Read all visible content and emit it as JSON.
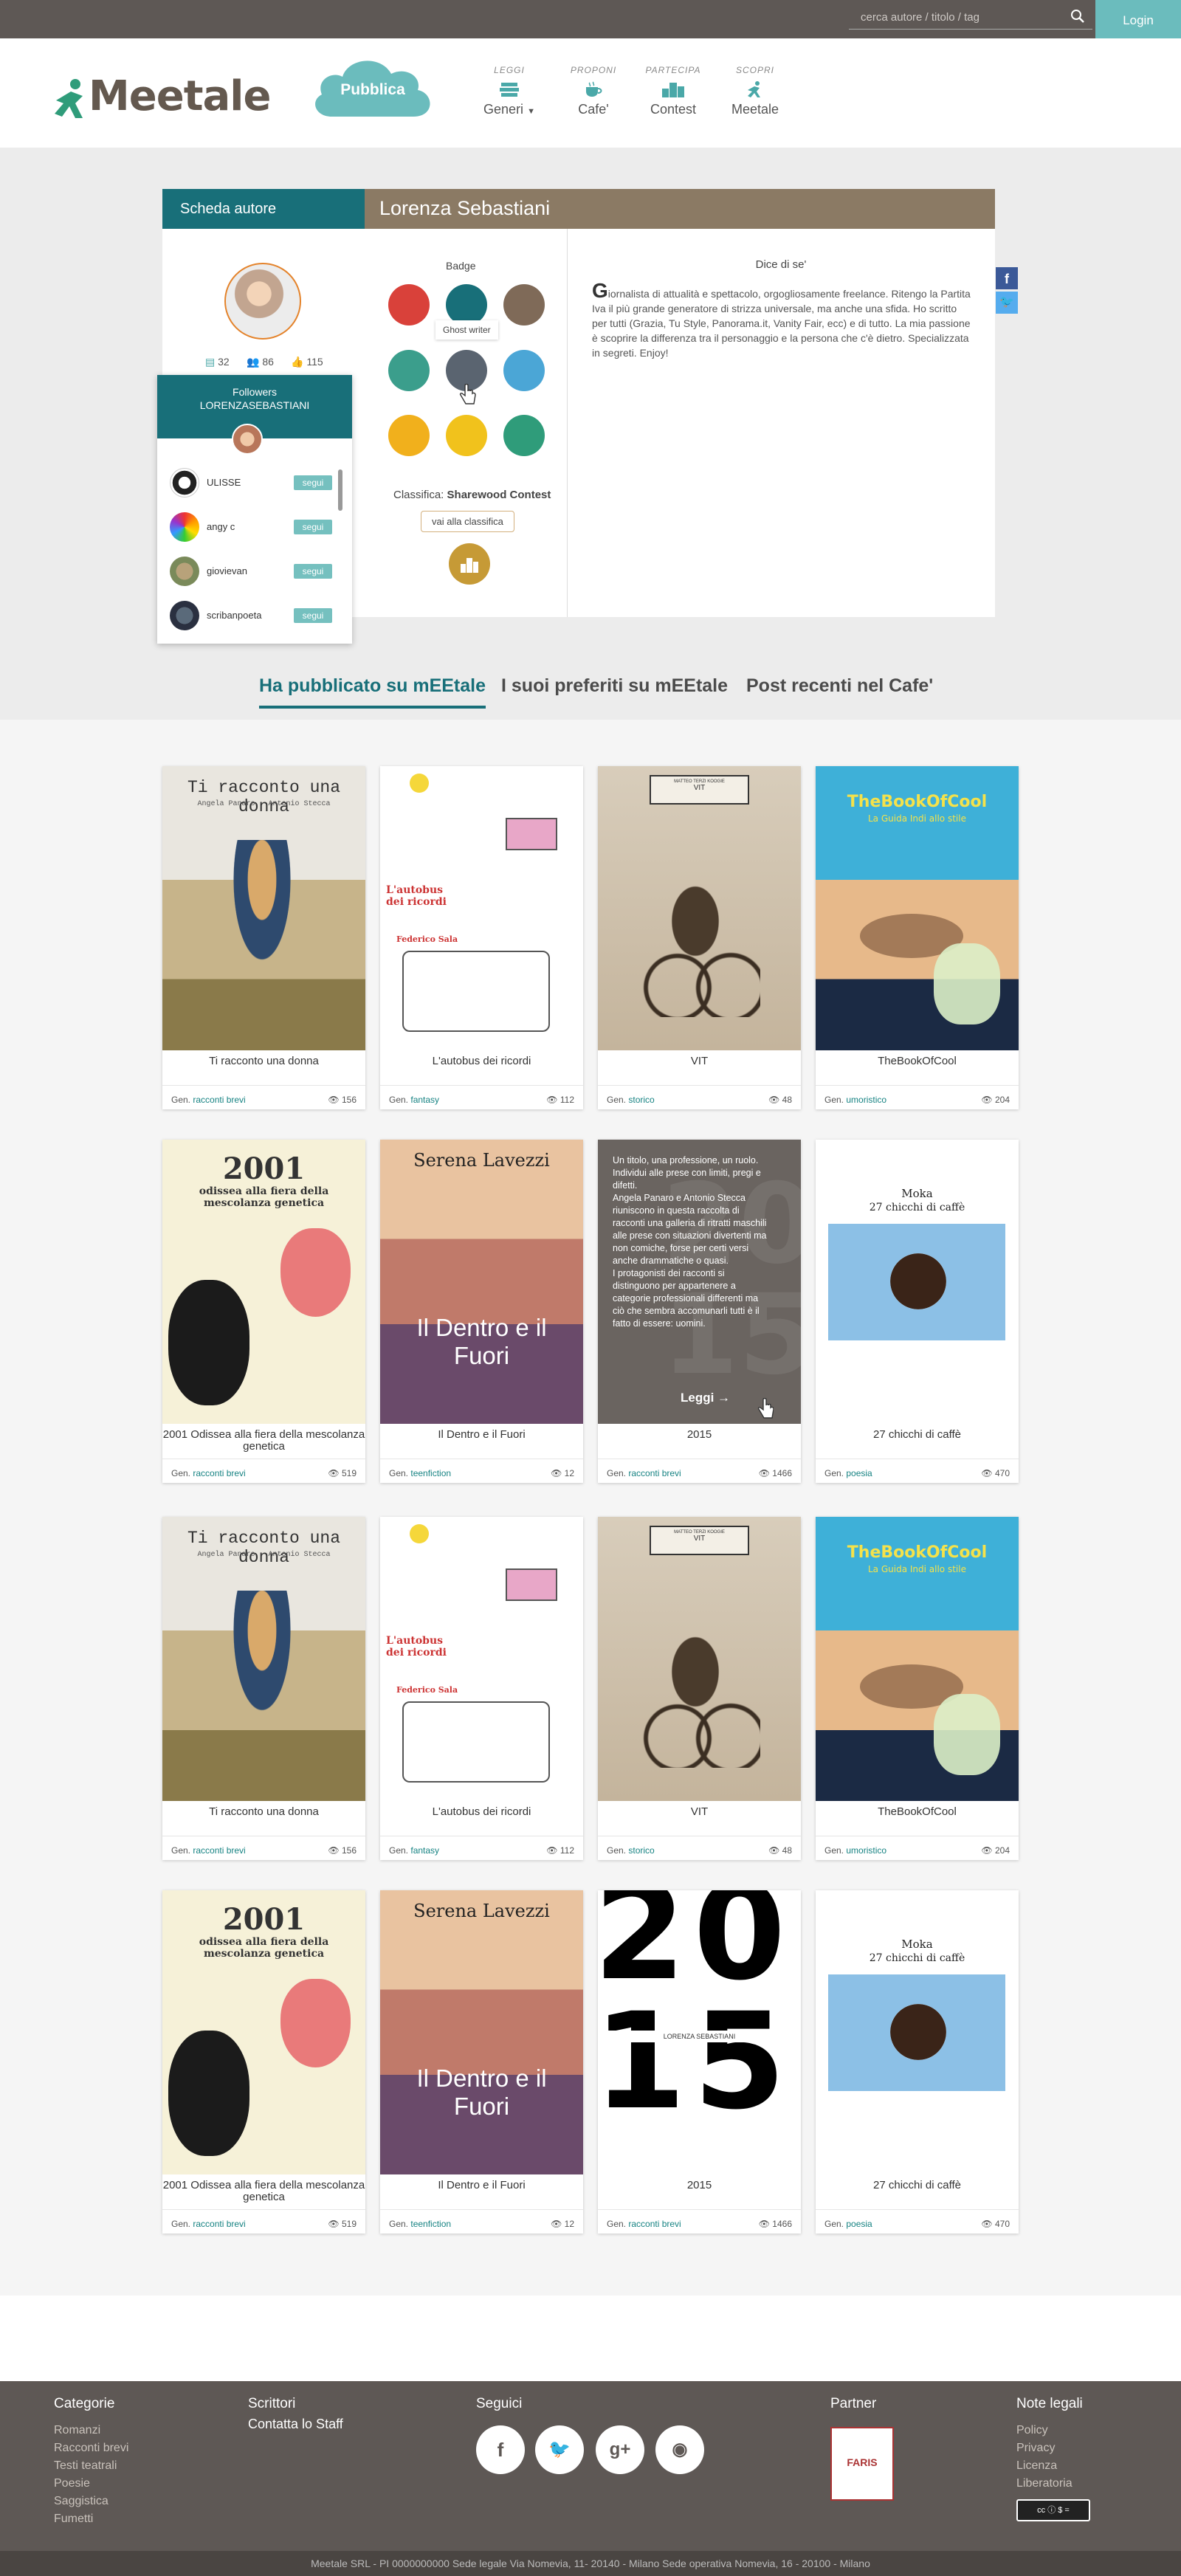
{
  "topbar": {
    "search_placeholder": "cerca autore / titolo / tag",
    "login": "Login"
  },
  "header": {
    "logo": "Meetale",
    "pubblica": "Pubblica",
    "nav": [
      {
        "caption": "LEGGI",
        "label": "Generi"
      },
      {
        "caption": "PROPONI",
        "label": "Cafe'"
      },
      {
        "caption": "PARTECIPA",
        "label": "Contest"
      },
      {
        "caption": "SCOPRI",
        "label": "Meetale"
      }
    ]
  },
  "author": {
    "scheda": "Scheda autore",
    "name": "Lorenza Sebastiani",
    "stats": [
      "32",
      "86",
      "115"
    ],
    "badge_label": "Badge",
    "ghost_tooltip": "Ghost writer",
    "classifica_label": "Classifica:",
    "classifica_name": "Sharewood Contest",
    "vai_classifica": "vai alla classifica",
    "dice_title": "Dice di se'",
    "bio": "Giornalista di attualità e spettacolo, orgogliosamente freelance. Ritengo la Partita Iva il più grande generatore di strizza universale, ma anche una sfida. Ho scritto per tutti (Grazia, Tu Style, Panorama.it, Vanity Fair, ecc) e di tutto. La mia passione è scoprire la differenza tra il personaggio e la persona che c'è dietro. Specializzata in segreti. Enjoy!",
    "colors": {
      "teal": "#186f79",
      "brown": "#8b7a64"
    }
  },
  "followers": {
    "title": "Followers",
    "subtitle": "LORENZASEBASTIANI",
    "follow_label": "segui",
    "items": [
      {
        "name": "ULISSE"
      },
      {
        "name": "angy c"
      },
      {
        "name": "giovievan"
      },
      {
        "name": "scribanpoeta"
      }
    ]
  },
  "tabs": [
    "Ha pubblicato su mEEtale",
    "I suoi preferiti su mEEtale",
    "Post recenti nel Cafe'"
  ],
  "gen_prefix": "Gen.",
  "hover": {
    "text": "Un titolo, una professione, un ruolo. Individui alle prese con limiti, pregi e difetti.\nAngela Panaro e Antonio Stecca riuniscono in questa raccolta di racconti una galleria di ritratti maschili alle prese con situazioni divertenti ma non comiche, forse per certi versi anche drammatiche o quasi.\nI protagonisti dei racconti si distinguono per appartenere a categorie professionali differenti ma ciò che sembra accomunarli tutti è il fatto di essere: uomini.",
    "leggi": "Leggi →"
  },
  "books": [
    {
      "title": "Ti racconto una donna",
      "genre": "racconti brevi",
      "views": "156",
      "cover": "donna",
      "cover_title": "Ti racconto una donna",
      "cover_sub": "Angela Panaro - Antonio Stecca"
    },
    {
      "title": "L'autobus dei ricordi",
      "genre": "fantasy",
      "views": "112",
      "cover": "autobus",
      "cover_title": "L'autobus dei ricordi",
      "cover_sub": "Federico Sala"
    },
    {
      "title": "VIT",
      "genre": "storico",
      "views": "48",
      "cover": "vit",
      "cover_title": "VIT",
      "cover_sub": "MATTEO TERZI KOOGIE"
    },
    {
      "title": "TheBookOfCool",
      "genre": "umoristico",
      "views": "204",
      "cover": "cool",
      "cover_title": "TheBookOfCool",
      "cover_sub": "La Guida Indi allo stile"
    },
    {
      "title": "2001 Odissea alla fiera della mescolanza genetica",
      "genre": "racconti brevi",
      "views": "519",
      "cover": "odissea",
      "cover_title": "2001",
      "cover_sub": "odissea alla fiera della mescolanza genetica"
    },
    {
      "title": "Il Dentro e il Fuori",
      "genre": "teenfiction",
      "views": "12",
      "cover": "dentro",
      "cover_title": "Il Dentro e il Fuori",
      "cover_sub": "Serena Lavezzi"
    },
    {
      "title": "2015",
      "genre": "racconti brevi",
      "views": "1466",
      "cover": "hover"
    },
    {
      "title": "27 chicchi di caffè",
      "genre": "poesia",
      "views": "470",
      "cover": "moka",
      "cover_title": "Moka",
      "cover_sub": "27 chicchi di caffè"
    },
    {
      "title": "Ti racconto una donna",
      "genre": "racconti brevi",
      "views": "156",
      "cover": "donna",
      "cover_title": "Ti racconto una donna",
      "cover_sub": "Angela Panaro - Antonio Stecca"
    },
    {
      "title": "L'autobus dei ricordi",
      "genre": "fantasy",
      "views": "112",
      "cover": "autobus",
      "cover_title": "L'autobus dei ricordi",
      "cover_sub": "Federico Sala"
    },
    {
      "title": "VIT",
      "genre": "storico",
      "views": "48",
      "cover": "vit",
      "cover_title": "VIT",
      "cover_sub": "MATTEO TERZI KOOGIE"
    },
    {
      "title": "TheBookOfCool",
      "genre": "umoristico",
      "views": "204",
      "cover": "cool",
      "cover_title": "TheBookOfCool",
      "cover_sub": "La Guida Indi allo stile"
    },
    {
      "title": "2001 Odissea alla fiera della mescolanza genetica",
      "genre": "racconti brevi",
      "views": "519",
      "cover": "odissea",
      "cover_title": "2001",
      "cover_sub": "odissea alla fiera della mescolanza genetica"
    },
    {
      "title": "Il Dentro e il Fuori",
      "genre": "teenfiction",
      "views": "12",
      "cover": "dentro",
      "cover_title": "Il Dentro e il Fuori",
      "cover_sub": "Serena Lavezzi"
    },
    {
      "title": "2015",
      "genre": "racconti brevi",
      "views": "1466",
      "cover": "y2015",
      "cover_title": "2015",
      "cover_sub": "LORENZA SEBASTIANI"
    },
    {
      "title": "27 chicchi di caffè",
      "genre": "poesia",
      "views": "470",
      "cover": "moka",
      "cover_title": "Moka",
      "cover_sub": "27 chicchi di caffè"
    }
  ],
  "footer": {
    "categorie_title": "Categorie",
    "categorie": [
      "Romanzi",
      "Racconti brevi",
      "Testi teatrali",
      "Poesie",
      "Saggistica",
      "Fumetti"
    ],
    "scrittori_title": "Scrittori",
    "contatta": "Contatta lo Staff",
    "seguici_title": "Seguici",
    "partner_title": "Partner",
    "partner_logo_text": "FARIS",
    "note_title": "Note legali",
    "note": [
      "Policy",
      "Privacy",
      "Licenza",
      "Liberatoria"
    ],
    "legal": "Meetale SRL - PI 0000000000  Sede legale  Via Nomevia, 11- 20140 - Milano  Sede operativa Nomevia, 16 - 20100 - Milano"
  }
}
